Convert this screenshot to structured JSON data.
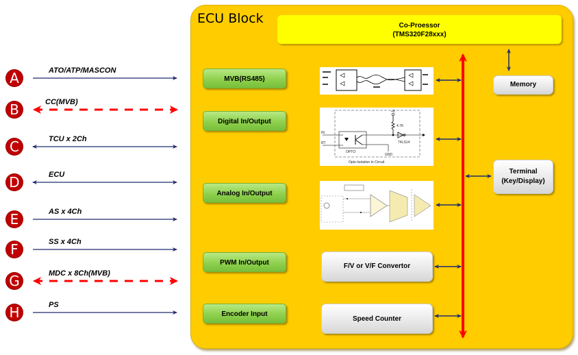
{
  "signals": [
    {
      "badge": "A",
      "label": "ATO/ATP/MASCON",
      "style": "solid",
      "direction": "in"
    },
    {
      "badge": "B",
      "label": "CC(MVB)",
      "style": "dashed",
      "direction": "both"
    },
    {
      "badge": "C",
      "label": "TCU x 2Ch",
      "style": "solid",
      "direction": "both"
    },
    {
      "badge": "D",
      "label": "ECU",
      "style": "solid",
      "direction": "both"
    },
    {
      "badge": "E",
      "label": "AS x 4Ch",
      "style": "solid",
      "direction": "in"
    },
    {
      "badge": "F",
      "label": "SS x 4Ch",
      "style": "solid",
      "direction": "in"
    },
    {
      "badge": "G",
      "label": "MDC x 8Ch(MVB)",
      "style": "dashed",
      "direction": "both"
    },
    {
      "badge": "H",
      "label": "PS",
      "style": "solid",
      "direction": "in"
    }
  ],
  "ecu": {
    "title": "ECU Block",
    "coprocessor": {
      "line1": "Co-Proessor",
      "line2": "(TMS320F28xxx)"
    },
    "interfaces": [
      {
        "label": "MVB(RS485)",
        "attached": "circuit-rs485"
      },
      {
        "label": "Digital In/Output",
        "attached": "circuit-opto"
      },
      {
        "label": "Analog  In/Output",
        "attached": "circuit-isolation-amp"
      },
      {
        "label": "PWM  In/Output",
        "attached": "F/V or V/F Convertor"
      },
      {
        "label": "Encoder Input",
        "attached": "Speed Counter"
      }
    ],
    "converters": {
      "fv": "F/V or V/F Convertor",
      "speed": "Speed Counter"
    },
    "memory": "Memory",
    "terminal": {
      "line1": "Terminal",
      "line2": "(Key/Display)"
    },
    "circuits": {
      "opto_caption": "Opto-Isolation In Circuit",
      "opto_in": "IN",
      "opto_rt": "RT",
      "opto_label": "OPTO",
      "opto_vcc": "+5",
      "opto_res": "4.7K",
      "opto_gate": "74LS14",
      "opto_gnd": "GND"
    }
  },
  "colors": {
    "badge": "#c00000",
    "ecu_fill": "#ffcc00",
    "coprocessor": "#ffff00",
    "bus": "#ff0000",
    "arrow": "#1f2a6b",
    "interface_green": "#8fd14f"
  }
}
